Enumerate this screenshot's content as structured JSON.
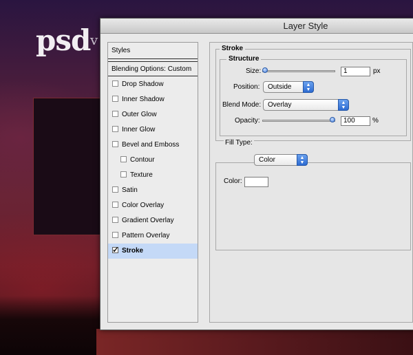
{
  "background": {
    "logo_text": "psd",
    "logo_tail": "v"
  },
  "dialog": {
    "title": "Layer Style"
  },
  "styles_list": {
    "header": "Styles",
    "blending_options": "Blending Options: Custom",
    "items": [
      {
        "label": "Drop Shadow",
        "checked": false,
        "indent": false,
        "selected": false
      },
      {
        "label": "Inner Shadow",
        "checked": false,
        "indent": false,
        "selected": false
      },
      {
        "label": "Outer Glow",
        "checked": false,
        "indent": false,
        "selected": false
      },
      {
        "label": "Inner Glow",
        "checked": false,
        "indent": false,
        "selected": false
      },
      {
        "label": "Bevel and Emboss",
        "checked": false,
        "indent": false,
        "selected": false
      },
      {
        "label": "Contour",
        "checked": false,
        "indent": true,
        "selected": false
      },
      {
        "label": "Texture",
        "checked": false,
        "indent": true,
        "selected": false
      },
      {
        "label": "Satin",
        "checked": false,
        "indent": false,
        "selected": false
      },
      {
        "label": "Color Overlay",
        "checked": false,
        "indent": false,
        "selected": false
      },
      {
        "label": "Gradient Overlay",
        "checked": false,
        "indent": false,
        "selected": false
      },
      {
        "label": "Pattern Overlay",
        "checked": false,
        "indent": false,
        "selected": false
      },
      {
        "label": "Stroke",
        "checked": true,
        "indent": false,
        "selected": true
      }
    ]
  },
  "stroke": {
    "section_title": "Stroke",
    "structure_title": "Structure",
    "size_label": "Size:",
    "size_value": "1",
    "size_unit": "px",
    "size_slider_fraction": 0.0,
    "position_label": "Position:",
    "position_value": "Outside",
    "blend_mode_label": "Blend Mode:",
    "blend_mode_value": "Overlay",
    "opacity_label": "Opacity:",
    "opacity_value": "100",
    "opacity_unit": "%",
    "opacity_slider_fraction": 1.0,
    "fill_type_label": "Fill Type:",
    "fill_type_value": "Color",
    "color_label": "Color:",
    "color_value": "#ffffff"
  },
  "colors": {
    "selected_row": "#c4d9f7",
    "select_accent": "#2d6bd1"
  }
}
